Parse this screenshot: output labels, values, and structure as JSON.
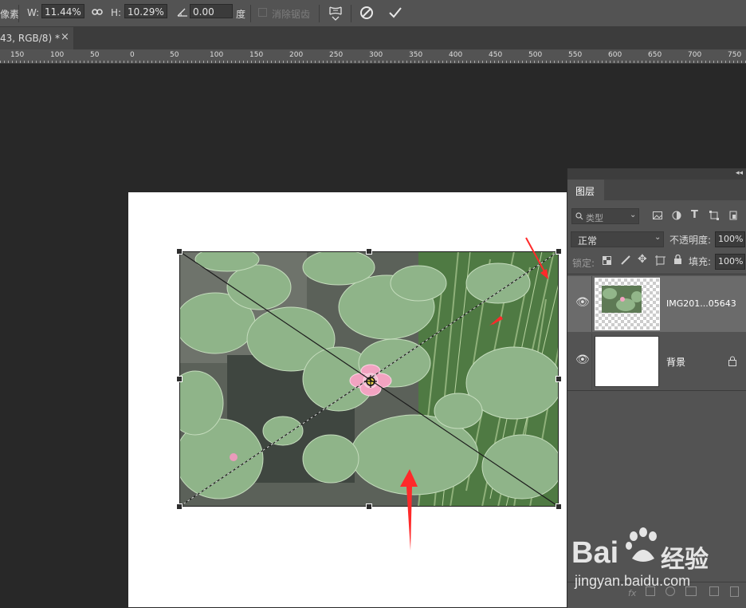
{
  "options_bar": {
    "unit_fragment": "像素",
    "w_label": "W:",
    "w_value": "11.44%",
    "h_label": "H:",
    "h_value": "10.29%",
    "angle_value": "0.00",
    "degree_label": "度",
    "antialias_label": "消除锯齿"
  },
  "document_tab": {
    "title": "43, RGB/8) *",
    "close": "×"
  },
  "ruler": {
    "labels": [
      "150",
      "100",
      "50",
      "0",
      "50",
      "100",
      "150",
      "200",
      "250",
      "300",
      "350",
      "400",
      "450",
      "500",
      "550",
      "600",
      "650",
      "700",
      "750"
    ]
  },
  "layers_panel": {
    "collapse_icon": "◂◂",
    "tab_label": "图层",
    "filter_placeholder": "类型",
    "blend_mode": "正常",
    "opacity_label": "不透明度:",
    "opacity_value": "100%",
    "lock_label": "锁定:",
    "fill_label": "填充:",
    "fill_value": "100%",
    "layers": [
      {
        "name": "IMG201...05643",
        "selected": true
      },
      {
        "name": "背景",
        "selected": false
      }
    ]
  },
  "watermark": {
    "brand": "Bai",
    "brand_suffix": "经验",
    "url": "jingyan.baidu.com"
  },
  "colors": {
    "accent_arrow": "#ff2a2a",
    "panel_bg": "#535353",
    "selected_layer_bg": "#6b6b6b"
  }
}
